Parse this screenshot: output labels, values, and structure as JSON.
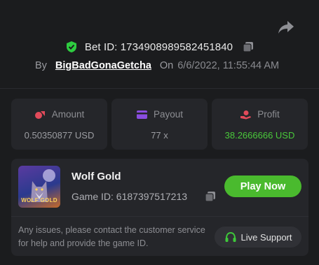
{
  "bet": {
    "id_label": "Bet ID: 1734908989582451840",
    "by_label": "By",
    "username": "BigBadGonaGetcha",
    "on_label": "On",
    "date": "6/6/2022, 11:55:44 AM"
  },
  "stats": [
    {
      "label": "Amount",
      "value": "0.50350877 USD",
      "icon": "chips-icon",
      "color": "#e24a5a"
    },
    {
      "label": "Payout",
      "value": "77 x",
      "icon": "card-icon",
      "color": "#8a4de0"
    },
    {
      "label": "Profit",
      "value": "38.2666666 USD",
      "icon": "money-hand-icon",
      "color": "#e24a5a",
      "value_color": "#49c93a"
    }
  ],
  "game": {
    "thumb_text": "WOLF GOLD",
    "name": "Wolf Gold",
    "id_label": "Game ID: 6187397517213",
    "play_label": "Play Now"
  },
  "support": {
    "issue_text": "Any issues, please contact the customer service for help and provide the game ID.",
    "button_label": "Live Support"
  },
  "colors": {
    "background": "#1b1c1e",
    "card": "#25262a",
    "accent_green": "#4aba2e",
    "shield_green": "#2ecc40"
  }
}
